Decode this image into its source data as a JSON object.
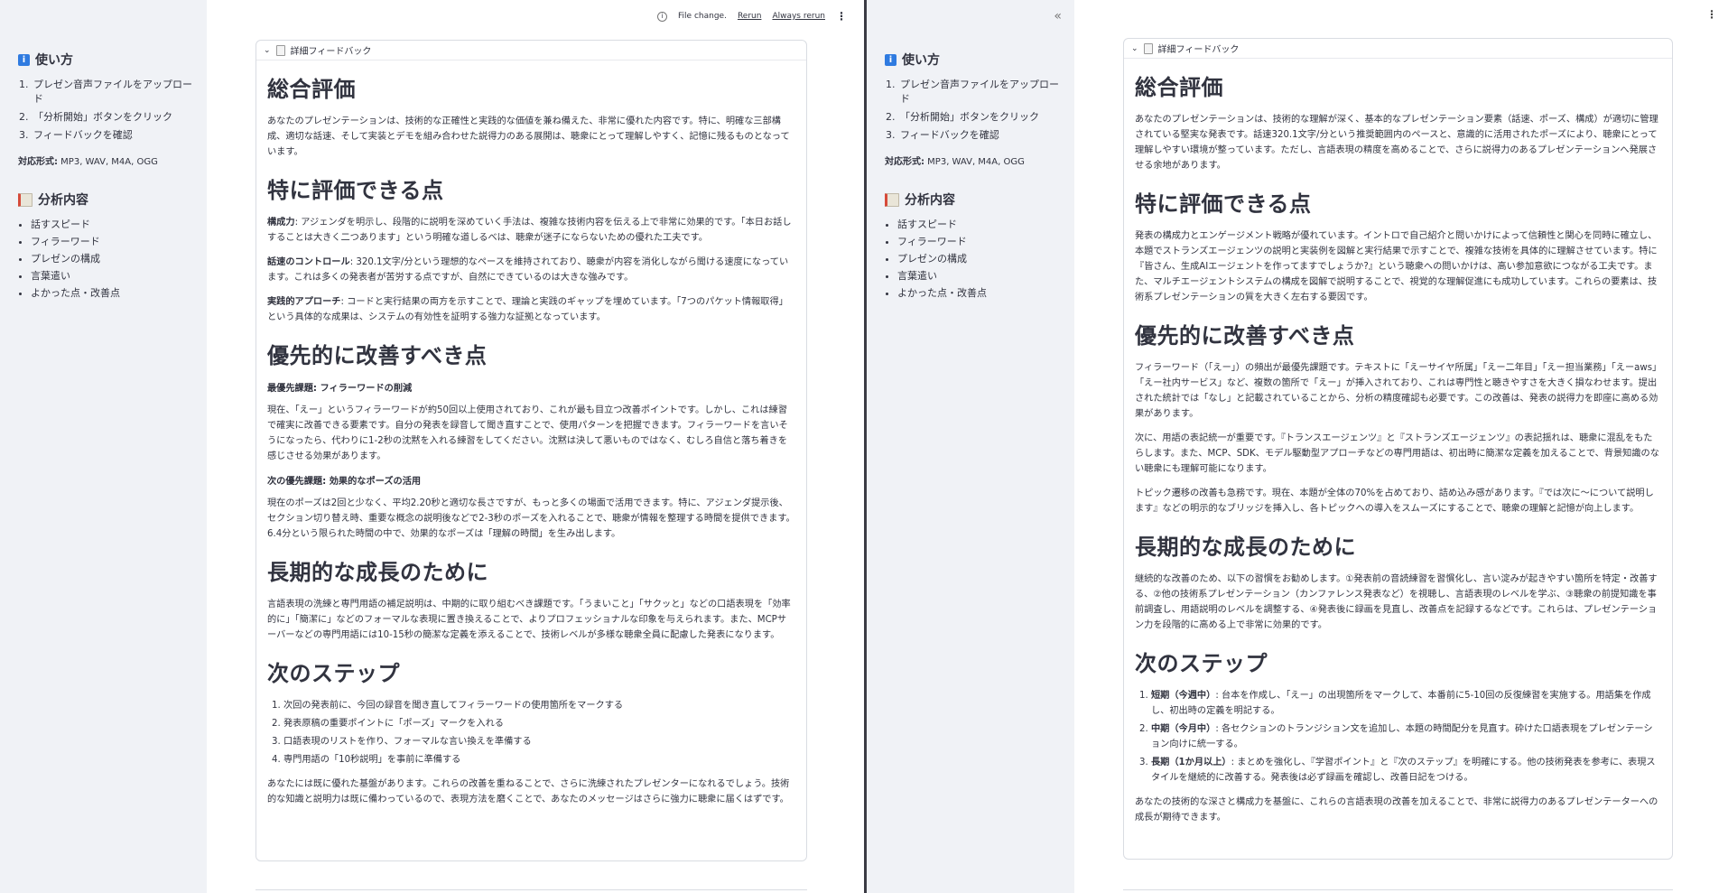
{
  "left": {
    "toolbar": {
      "file_change": "File change.",
      "rerun": "Rerun",
      "always_rerun": "Always rerun"
    },
    "sidebar": {
      "howto_title": "使い方",
      "steps": [
        "プレゼン音声ファイルをアップロード",
        "「分析開始」ボタンをクリック",
        "フィードバックを確認"
      ],
      "formats_label": "対応形式:",
      "formats_value": " MP3, WAV, M4A, OGG",
      "analysis_title": "分析内容",
      "analysis_items": [
        "話すスピード",
        "フィラーワード",
        "プレゼンの構成",
        "言葉遣い",
        "よかった点・改善点"
      ]
    },
    "expander_title": "詳細フィードバック",
    "overall": {
      "heading": "総合評価",
      "text": "あなたのプレゼンテーションは、技術的な正確性と実践的な価値を兼ね備えた、非常に優れた内容です。特に、明確な三部構成、適切な話速、そして実装とデモを組み合わせた説得力のある展開は、聴衆にとって理解しやすく、記憶に残るものとなっています。"
    },
    "strengths": {
      "heading": "特に評価できる点",
      "items": [
        {
          "lead": "構成力",
          "text": ": アジェンダを明示し、段階的に説明を深めていく手法は、複雑な技術内容を伝える上で非常に効果的です。「本日お話しすることは大きく二つあります」という明確な道しるべは、聴衆が迷子にならないための優れた工夫です。"
        },
        {
          "lead": "話速のコントロール",
          "text": ": 320.1文字/分という理想的なペースを維持されており、聴衆が内容を消化しながら聞ける速度になっています。これは多くの発表者が苦労する点ですが、自然にできているのは大きな強みです。"
        },
        {
          "lead": "実践的アプローチ",
          "text": ": コードと実行結果の両方を示すことで、理論と実践のギャップを埋めています。「7つのパケット情報取得」という具体的な成果は、システムの有効性を証明する強力な証拠となっています。"
        }
      ]
    },
    "improvements": {
      "heading": "優先的に改善すべき点",
      "first_title": "最優先課題: フィラーワードの削減",
      "first_text": "現在、「えー」というフィラーワードが約50回以上使用されており、これが最も目立つ改善ポイントです。しかし、これは練習で確実に改善できる要素です。自分の発表を録音して聞き直すことで、使用パターンを把握できます。フィラーワードを言いそうになったら、代わりに1-2秒の沈黙を入れる練習をしてください。沈黙は決して悪いものではなく、むしろ自信と落ち着きを感じさせる効果があります。",
      "second_title": "次の優先課題: 効果的なポーズの活用",
      "second_text": "現在のポーズは2回と少なく、平均2.20秒と適切な長さですが、もっと多くの場面で活用できます。特に、アジェンダ提示後、セクション切り替え時、重要な概念の説明後などで2-3秒のポーズを入れることで、聴衆が情報を整理する時間を提供できます。6.4分という限られた時間の中で、効果的なポーズは「理解の時間」を生み出します。"
    },
    "growth": {
      "heading": "長期的な成長のために",
      "text": "言語表現の洗練と専門用語の補足説明は、中期的に取り組むべき課題です。「うまいこと」「サクッと」などの口語表現を「効率的に」「簡潔に」などのフォーマルな表現に置き換えることで、よりプロフェッショナルな印象を与えられます。また、MCPサーバーなどの専門用語には10-15秒の簡潔な定義を添えることで、技術レベルが多様な聴衆全員に配慮した発表になります。"
    },
    "next": {
      "heading": "次のステップ",
      "steps": [
        "次回の発表前に、今回の録音を聞き直してフィラーワードの使用箇所をマークする",
        "発表原稿の重要ポイントに「ポーズ」マークを入れる",
        "口語表現のリストを作り、フォーマルな言い換えを準備する",
        "専門用語の「10秒説明」を事前に準備する"
      ],
      "closing": "あなたには既に優れた基盤があります。これらの改善を重ねることで、さらに洗練されたプレゼンターになれるでしょう。技術的な知識と説明力は既に備わっているので、表現方法を磨くことで、あなたのメッセージはさらに強力に聴衆に届くはずです。"
    }
  },
  "right": {
    "sidebar": {
      "collapse_icon": "«",
      "howto_title": "使い方",
      "steps": [
        "プレゼン音声ファイルをアップロード",
        "「分析開始」ボタンをクリック",
        "フィードバックを確認"
      ],
      "formats_label": "対応形式:",
      "formats_value": " MP3, WAV, M4A, OGG",
      "analysis_title": "分析内容",
      "analysis_items": [
        "話すスピード",
        "フィラーワード",
        "プレゼンの構成",
        "言葉遣い",
        "よかった点・改善点"
      ]
    },
    "expander_title": "詳細フィードバック",
    "overall": {
      "heading": "総合評価",
      "text": "あなたのプレゼンテーションは、技術的な理解が深く、基本的なプレゼンテーション要素（話速、ポーズ、構成）が適切に管理されている堅実な発表です。話速320.1文字/分という推奨範囲内のペースと、意識的に活用されたポーズにより、聴衆にとって理解しやすい環境が整っています。ただし、言語表現の精度を高めることで、さらに説得力のあるプレゼンテーションへ発展させる余地があります。"
    },
    "strengths": {
      "heading": "特に評価できる点",
      "text": "発表の構成力とエンゲージメント戦略が優れています。イントロで自己紹介と問いかけによって信頼性と関心を同時に確立し、本題でストランズエージェンツの説明と実装例を図解と実行結果で示すことで、複雑な技術を具体的に理解させています。特に『皆さん、生成AIエージェントを作ってますでしょうか?』という聴衆への問いかけは、高い参加意欲につながる工夫です。また、マルチエージェントシステムの構成を図解で説明することで、視覚的な理解促進にも成功しています。これらの要素は、技術系プレゼンテーションの質を大きく左右する要因です。"
    },
    "improvements": {
      "heading": "優先的に改善すべき点",
      "paragraphs": [
        "フィラーワード（「えー」）の頻出が最優先課題です。テキストに「えーサイヤ所属」「えー二年目」「えー担当業務」「えーaws」「えー社内サービス」など、複数の箇所で「えー」が挿入されており、これは専門性と聴きやすさを大きく損なわせます。提出された統計では「なし」と記載されていることから、分析の精度確認も必要です。この改善は、発表の説得力を即座に高める効果があります。",
        "次に、用語の表記統一が重要です。『トランスエージェンツ』と『ストランズエージェンツ』の表記揺れは、聴衆に混乱をもたらします。また、MCP、SDK、モデル駆動型アプローチなどの専門用語は、初出時に簡潔な定義を加えることで、背景知識のない聴衆にも理解可能になります。",
        "トピック遷移の改善も急務です。現在、本題が全体の70%を占めており、詰め込み感があります。『では次に〜について説明します』などの明示的なブリッジを挿入し、各トピックへの導入をスムーズにすることで、聴衆の理解と記憶が向上します。"
      ]
    },
    "growth": {
      "heading": "長期的な成長のために",
      "text": "継続的な改善のため、以下の習慣をお勧めします。①発表前の音読練習を習慣化し、言い淀みが起きやすい箇所を特定・改善する、②他の技術系プレゼンテーション（カンファレンス発表など）を視聴し、言語表現のレベルを学ぶ、③聴衆の前提知識を事前調査し、用語説明のレベルを調整する、④発表後に録画を見直し、改善点を記録するなどです。これらは、プレゼンテーション力を段階的に高める上で非常に効果的です。"
    },
    "next": {
      "heading": "次のステップ",
      "steps": [
        {
          "lead": "短期（今週中）",
          "text": ": 台本を作成し、「えー」の出現箇所をマークして、本番前に5-10回の反復練習を実施する。用語集を作成し、初出時の定義を明記する。"
        },
        {
          "lead": "中期（今月中）",
          "text": ": 各セクションのトランジション文を追加し、本題の時間配分を見直す。砕けた口語表現をプレゼンテーション向けに統一する。"
        },
        {
          "lead": "長期（1か月以上）",
          "text": ": まとめを強化し、『学習ポイント』と『次のステップ』を明確にする。他の技術発表を参考に、表現スタイルを継続的に改善する。発表後は必ず録画を確認し、改善日記をつける。"
        }
      ],
      "closing": "あなたの技術的な深さと構成力を基盤に、これらの言語表現の改善を加えることで、非常に説得力のあるプレゼンテーターへの成長が期待できます。"
    }
  }
}
